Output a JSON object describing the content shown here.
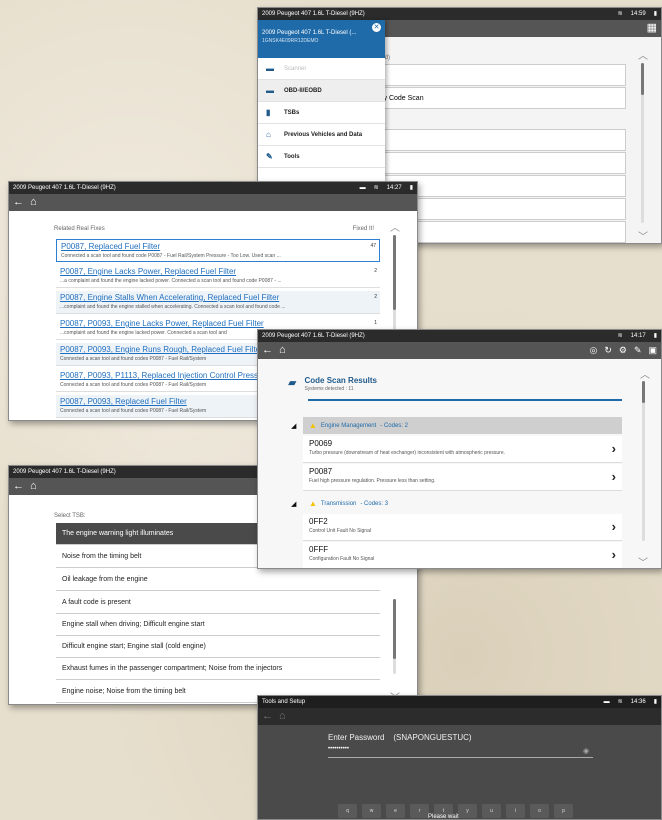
{
  "screen1": {
    "status_title": "2009 Peugeot 407 1.6L T-Diesel (9HZ)",
    "time": "14:59",
    "drawer_title": "2009 Peugeot 407 1.6L T-Diesel (...",
    "drawer_vin": "1GNSK4E09RR12DEMO",
    "menu": [
      {
        "label": "Scanner",
        "icon": "car-icon"
      },
      {
        "label": "OBD-II/EOBD",
        "icon": "obd-icon"
      },
      {
        "label": "TSBs",
        "icon": "book-icon"
      },
      {
        "label": "Previous Vehicles and Data",
        "icon": "garage-icon"
      },
      {
        "label": "Tools",
        "icon": "wrench-icon"
      }
    ],
    "bg_label": "Fitted)",
    "bg_row": "d By Code Scan",
    "bg_row2": "t"
  },
  "screen2": {
    "status_title": "2009 Peugeot 407 1.6L T-Diesel (9HZ)",
    "time": "14:27",
    "header_left": "Related Real Fixes",
    "header_right": "Fixed It!",
    "fixes": [
      {
        "title": "P0087, Replaced Fuel Filter",
        "desc": "Connected a scan tool and found code P0087 - Fuel Rail/System Pressure - Too Low. Used scan ...",
        "count": "47"
      },
      {
        "title": "P0087, Engine Lacks Power, Replaced Fuel Filter",
        "desc": "...a complaint and found the engine lacked power. Connected a scan tool and found code P0087 - ...",
        "count": "2"
      },
      {
        "title": "P0087, Engine Stalls When Accelerating, Replaced Fuel Filter",
        "desc": "...complaint and found the engine stalled when accelerating. Connected a scan tool and found code ...",
        "count": "2"
      },
      {
        "title": "P0087, P0093, Engine Lacks Power, Replaced Fuel Filter",
        "desc": "...complaint and found the engine lacked power. Connected a scan tool and",
        "count": "1"
      },
      {
        "title": "P0087, P0093, Engine Runs Rough, Replaced Fuel Filter",
        "desc": "Connected a scan tool and found codes P0087 - Fuel Rail/System",
        "count": ""
      },
      {
        "title": "P0087, P0093, P1113, Replaced Injection Control Pressure",
        "desc": "Connected a scan tool and found codes P0087 - Fuel Rail/System",
        "count": ""
      },
      {
        "title": "P0087, P0093, Replaced Fuel Filter",
        "desc": "Connected a scan tool and found codes P0087 - Fuel Rail/System",
        "count": ""
      }
    ]
  },
  "screen3": {
    "status_title": "2009 Peugeot 407 1.6L T-Diesel (9HZ)",
    "label": "Select TSB:",
    "items": [
      "The engine warning light illuminates",
      "Noise from the timing belt",
      "Oil leakage from the engine",
      "A fault code is present",
      "Engine stall when driving; Difficult engine start",
      "Difficult engine start; Engine stall (cold engine)",
      "Exhaust fumes in the passenger compartment; Noise from the injectors",
      "Engine noise; Noise from the timing belt"
    ]
  },
  "screen4": {
    "status_title": "2009 Peugeot 407 1.6L T-Diesel (9HZ)",
    "time": "14:17",
    "title": "Code Scan Results",
    "subtitle": "Systems detected : 11",
    "systems": [
      {
        "name": "Engine Management",
        "codes_label": "- Codes: 2",
        "codes": [
          {
            "code": "P0069",
            "desc": "Turbo pressure (downstream of heat exchanger) inconsistent with atmospheric pressure."
          },
          {
            "code": "P0087",
            "desc": "Fuel high pressure regulation. Pressure less than setting."
          }
        ]
      },
      {
        "name": "Transmission",
        "codes_label": "- Codes: 3",
        "codes": [
          {
            "code": "0FF2",
            "desc": "Control Unit Fault No Signal"
          },
          {
            "code": "0FFF",
            "desc": "Configuration Fault No Signal"
          }
        ]
      }
    ]
  },
  "screen5": {
    "status_title": "Tools and Setup",
    "time": "14:36",
    "label": "Enter Password",
    "hint": "(SNAPONGUESTUC)",
    "password": "••••••••••",
    "keys": [
      "q",
      "w",
      "e",
      "r",
      "t",
      "y",
      "u",
      "i",
      "o",
      "p"
    ],
    "wait": "Please wait"
  }
}
